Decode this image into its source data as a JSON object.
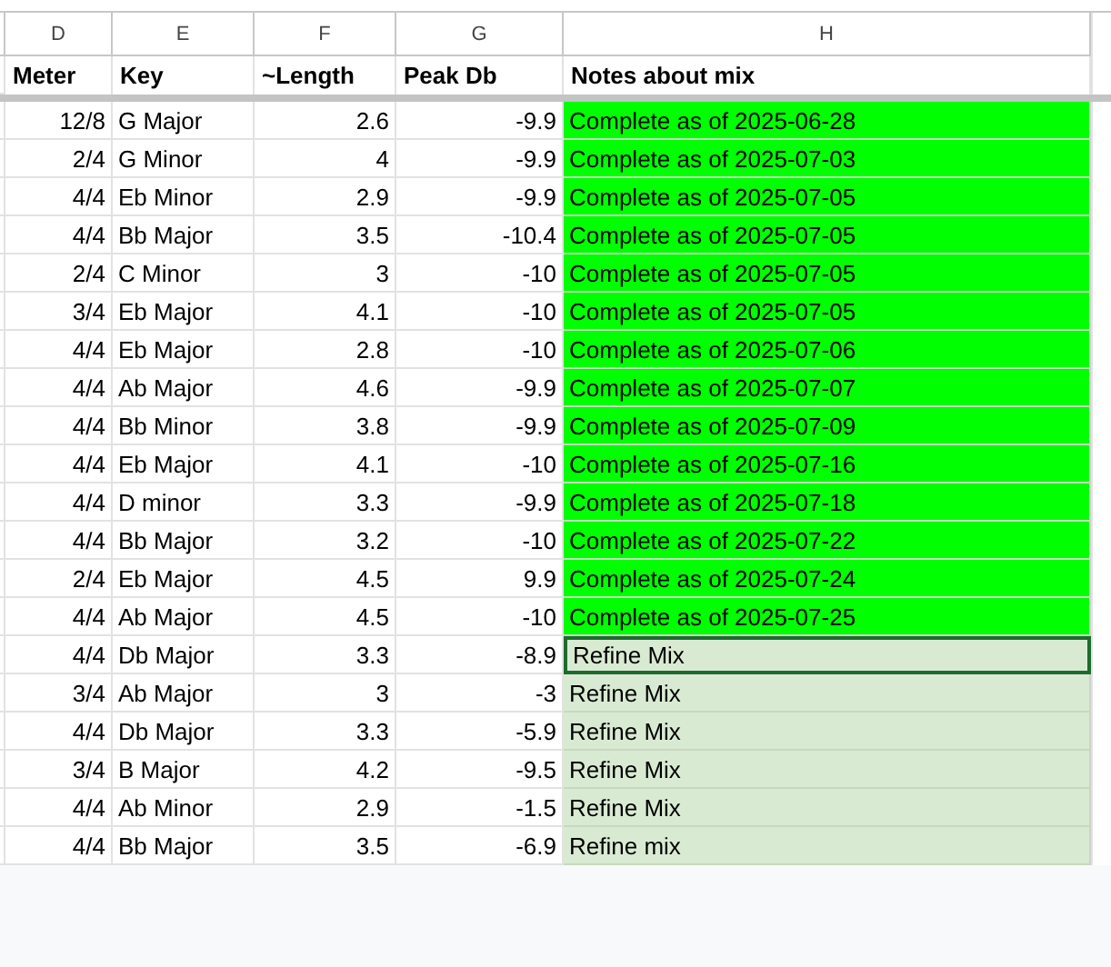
{
  "column_letters": [
    "D",
    "E",
    "F",
    "G",
    "H"
  ],
  "headers": [
    "Meter",
    "Key",
    "~Length",
    "Peak Db",
    "Notes about mix"
  ],
  "rows": [
    {
      "meter": "12/8",
      "key": "G Major",
      "length": "2.6",
      "peak": "-9.9",
      "notes": "Complete as of 2025-06-28",
      "color": "#00ff00",
      "selected": false
    },
    {
      "meter": "2/4",
      "key": "G Minor",
      "length": "4",
      "peak": "-9.9",
      "notes": "Complete as of 2025-07-03",
      "color": "#00ff00",
      "selected": false
    },
    {
      "meter": "4/4",
      "key": "Eb Minor",
      "length": "2.9",
      "peak": "-9.9",
      "notes": "Complete as of 2025-07-05",
      "color": "#00ff00",
      "selected": false
    },
    {
      "meter": "4/4",
      "key": "Bb Major",
      "length": "3.5",
      "peak": "-10.4",
      "notes": "Complete as of 2025-07-05",
      "color": "#00ff00",
      "selected": false
    },
    {
      "meter": "2/4",
      "key": "C Minor",
      "length": "3",
      "peak": "-10",
      "notes": "Complete as of 2025-07-05",
      "color": "#00ff00",
      "selected": false
    },
    {
      "meter": "3/4",
      "key": "Eb Major",
      "length": "4.1",
      "peak": "-10",
      "notes": "Complete as of 2025-07-05",
      "color": "#00ff00",
      "selected": false
    },
    {
      "meter": "4/4",
      "key": "Eb Major",
      "length": "2.8",
      "peak": "-10",
      "notes": "Complete as of 2025-07-06",
      "color": "#00ff00",
      "selected": false
    },
    {
      "meter": "4/4",
      "key": "Ab Major",
      "length": "4.6",
      "peak": "-9.9",
      "notes": "Complete as of 2025-07-07",
      "color": "#00ff00",
      "selected": false
    },
    {
      "meter": "4/4",
      "key": "Bb Minor",
      "length": "3.8",
      "peak": "-9.9",
      "notes": "Complete as of 2025-07-09",
      "color": "#00ff00",
      "selected": false
    },
    {
      "meter": "4/4",
      "key": "Eb Major",
      "length": "4.1",
      "peak": "-10",
      "notes": "Complete as of 2025-07-16",
      "color": "#00ff00",
      "selected": false
    },
    {
      "meter": "4/4",
      "key": "D minor",
      "length": "3.3",
      "peak": "-9.9",
      "notes": "Complete as of 2025-07-18",
      "color": "#00ff00",
      "selected": false
    },
    {
      "meter": "4/4",
      "key": "Bb Major",
      "length": "3.2",
      "peak": "-10",
      "notes": "Complete as of 2025-07-22",
      "color": "#00ff00",
      "selected": false
    },
    {
      "meter": "2/4",
      "key": "Eb Major",
      "length": "4.5",
      "peak": "9.9",
      "notes": "Complete as of 2025-07-24",
      "color": "#00ff00",
      "selected": false
    },
    {
      "meter": "4/4",
      "key": "Ab Major",
      "length": "4.5",
      "peak": "-10",
      "notes": "Complete as of 2025-07-25",
      "color": "#00ff00",
      "selected": false
    },
    {
      "meter": "4/4",
      "key": "Db Major",
      "length": "3.3",
      "peak": "-8.9",
      "notes": "Refine Mix",
      "color": "#d9ead3",
      "selected": true
    },
    {
      "meter": "3/4",
      "key": "Ab Major",
      "length": "3",
      "peak": "-3",
      "notes": "Refine Mix",
      "color": "#d9ead3",
      "selected": false
    },
    {
      "meter": "4/4",
      "key": "Db Major",
      "length": "3.3",
      "peak": "-5.9",
      "notes": "Refine Mix",
      "color": "#d9ead3",
      "selected": false
    },
    {
      "meter": "3/4",
      "key": "B Major",
      "length": "4.2",
      "peak": "-9.5",
      "notes": "Refine Mix",
      "color": "#d9ead3",
      "selected": false
    },
    {
      "meter": "4/4",
      "key": "Ab Minor",
      "length": "2.9",
      "peak": "-1.5",
      "notes": "Refine Mix",
      "color": "#d9ead3",
      "selected": false
    },
    {
      "meter": "4/4",
      "key": "Bb Major",
      "length": "3.5",
      "peak": "-6.9",
      "notes": "Refine mix",
      "color": "#d9ead3",
      "selected": false
    }
  ]
}
